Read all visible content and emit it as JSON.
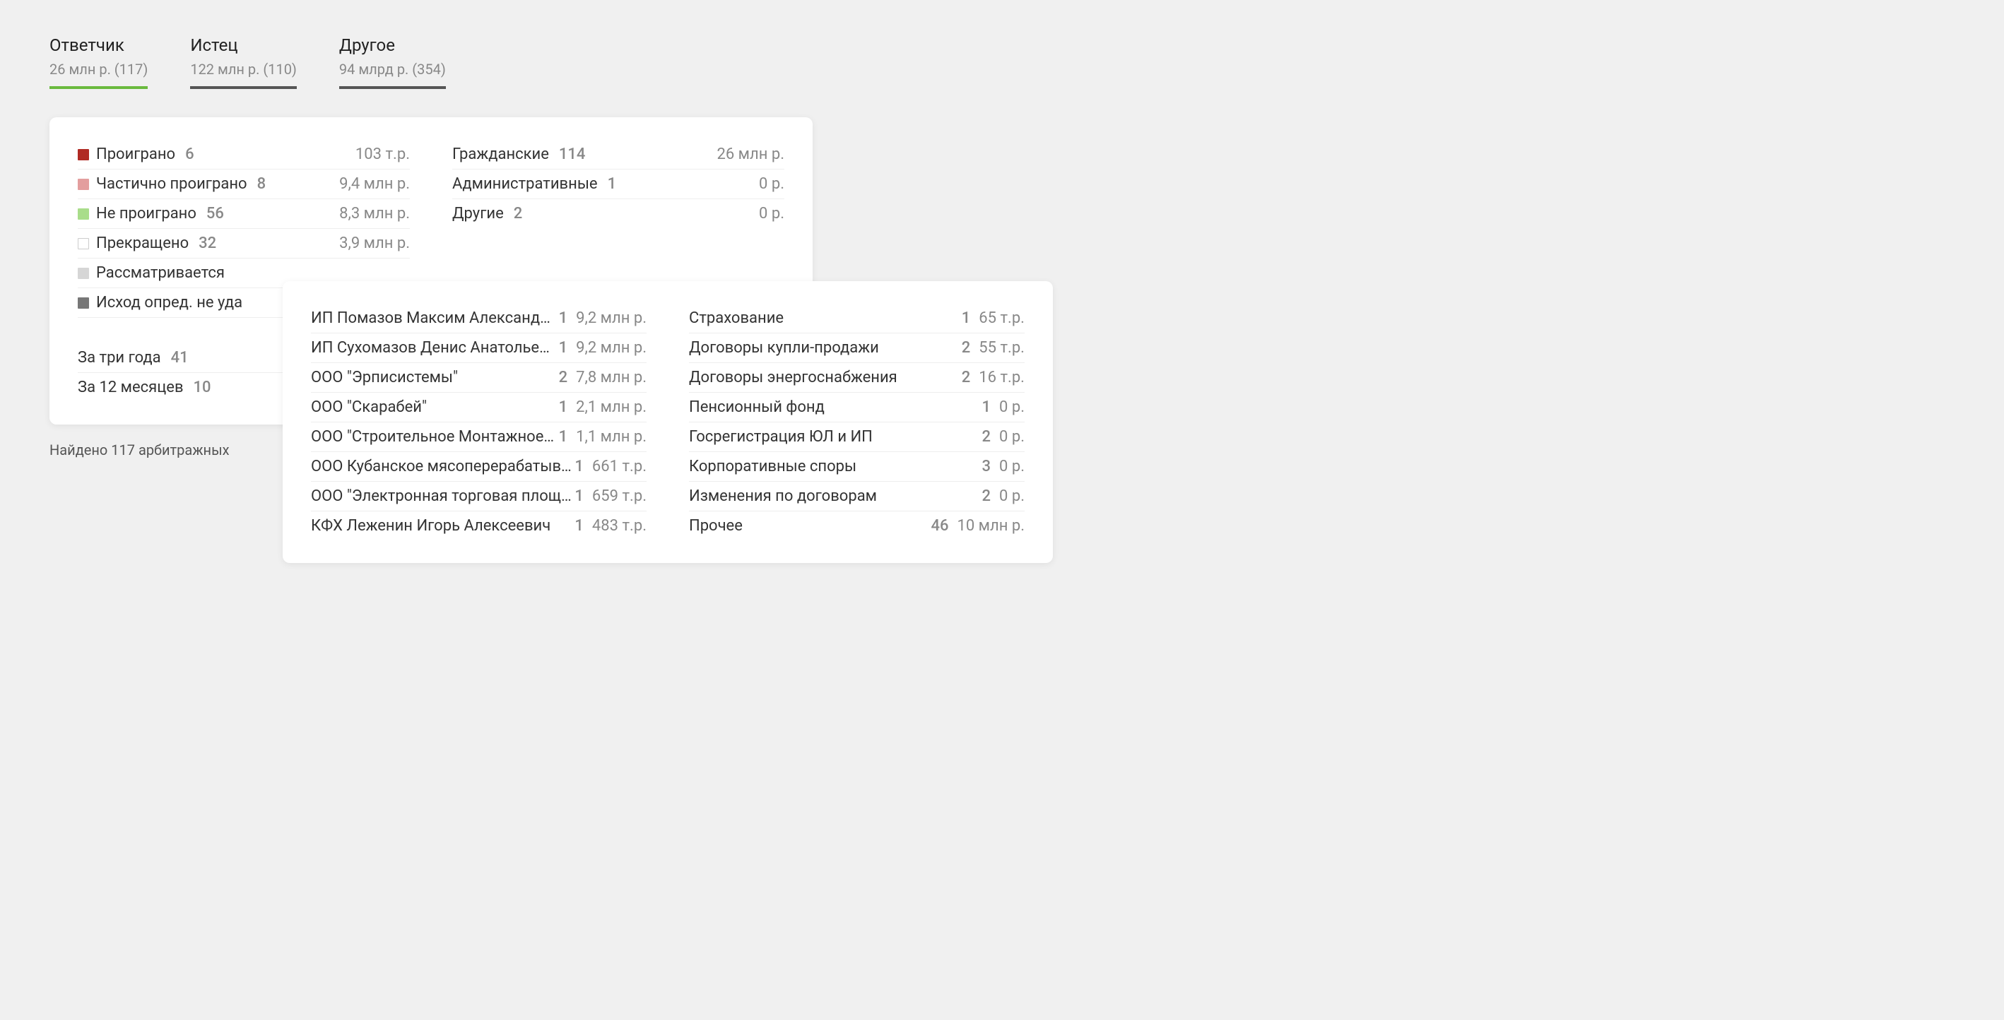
{
  "tabs": [
    {
      "title": "Ответчик",
      "sub": "26 млн р. (117)"
    },
    {
      "title": "Истец",
      "sub": "122 млн р. (110)"
    },
    {
      "title": "Другое",
      "sub": "94 млрд р. (354)"
    }
  ],
  "left_status": [
    {
      "label": "Проиграно",
      "count": "6",
      "value": "103 т.р."
    },
    {
      "label": "Частично проиграно",
      "count": "8",
      "value": "9,4 млн р."
    },
    {
      "label": "Не проиграно",
      "count": "56",
      "value": "8,3 млн р."
    },
    {
      "label": "Прекращено",
      "count": "32",
      "value": "3,9 млн р."
    },
    {
      "label": "Рассматривается",
      "count": "",
      "value": ""
    },
    {
      "label": "Исход опред. не уда",
      "count": "",
      "value": ""
    }
  ],
  "right_types": [
    {
      "label": "Гражданские",
      "count": "114",
      "value": "26 млн р."
    },
    {
      "label": "Административные",
      "count": "1",
      "value": "0 р."
    },
    {
      "label": "Другие",
      "count": "2",
      "value": "0 р."
    }
  ],
  "periods": [
    {
      "label": "За три года",
      "count": "41"
    },
    {
      "label": "За 12 месяцев",
      "count": "10"
    }
  ],
  "found_text": "Найдено 117 арбитражных",
  "overlay_left": [
    {
      "label": "ИП Помазов Максим Александрович",
      "count": "1",
      "value": "9,2 млн р."
    },
    {
      "label": "ИП Сухомазов Денис Анатольевич",
      "count": "1",
      "value": "9,2 млн р."
    },
    {
      "label": "ООО \"Эрписистемы\"",
      "count": "2",
      "value": "7,8 млн р."
    },
    {
      "label": "ООО \"Скарабей\"",
      "count": "1",
      "value": "2,1 млн р."
    },
    {
      "label": "ООО \"Строительное Монтажное Упра...",
      "count": "1",
      "value": "1,1 млн р."
    },
    {
      "label": "ООО Кубанское мясоперерабатывающе...",
      "count": "1",
      "value": "661 т.р."
    },
    {
      "label": "ООО \"Электронная торговая площадка ...",
      "count": "1",
      "value": "659 т.р."
    },
    {
      "label": "КФХ Леженин Игорь Алексеевич",
      "count": "1",
      "value": "483 т.р."
    }
  ],
  "overlay_right": [
    {
      "label": "Страхование",
      "count": "1",
      "value": "65 т.р."
    },
    {
      "label": "Договоры купли-продажи",
      "count": "2",
      "value": "55 т.р."
    },
    {
      "label": "Договоры энергоснабжения",
      "count": "2",
      "value": "16 т.р."
    },
    {
      "label": "Пенсионный фонд",
      "count": "1",
      "value": "0 р."
    },
    {
      "label": "Госрегистрация ЮЛ и ИП",
      "count": "2",
      "value": "0 р."
    },
    {
      "label": "Корпоративные споры",
      "count": "3",
      "value": "0 р."
    },
    {
      "label": "Изменения по договорам",
      "count": "2",
      "value": "0 р."
    },
    {
      "label": "Прочее",
      "count": "46",
      "value": "10 млн р."
    }
  ]
}
